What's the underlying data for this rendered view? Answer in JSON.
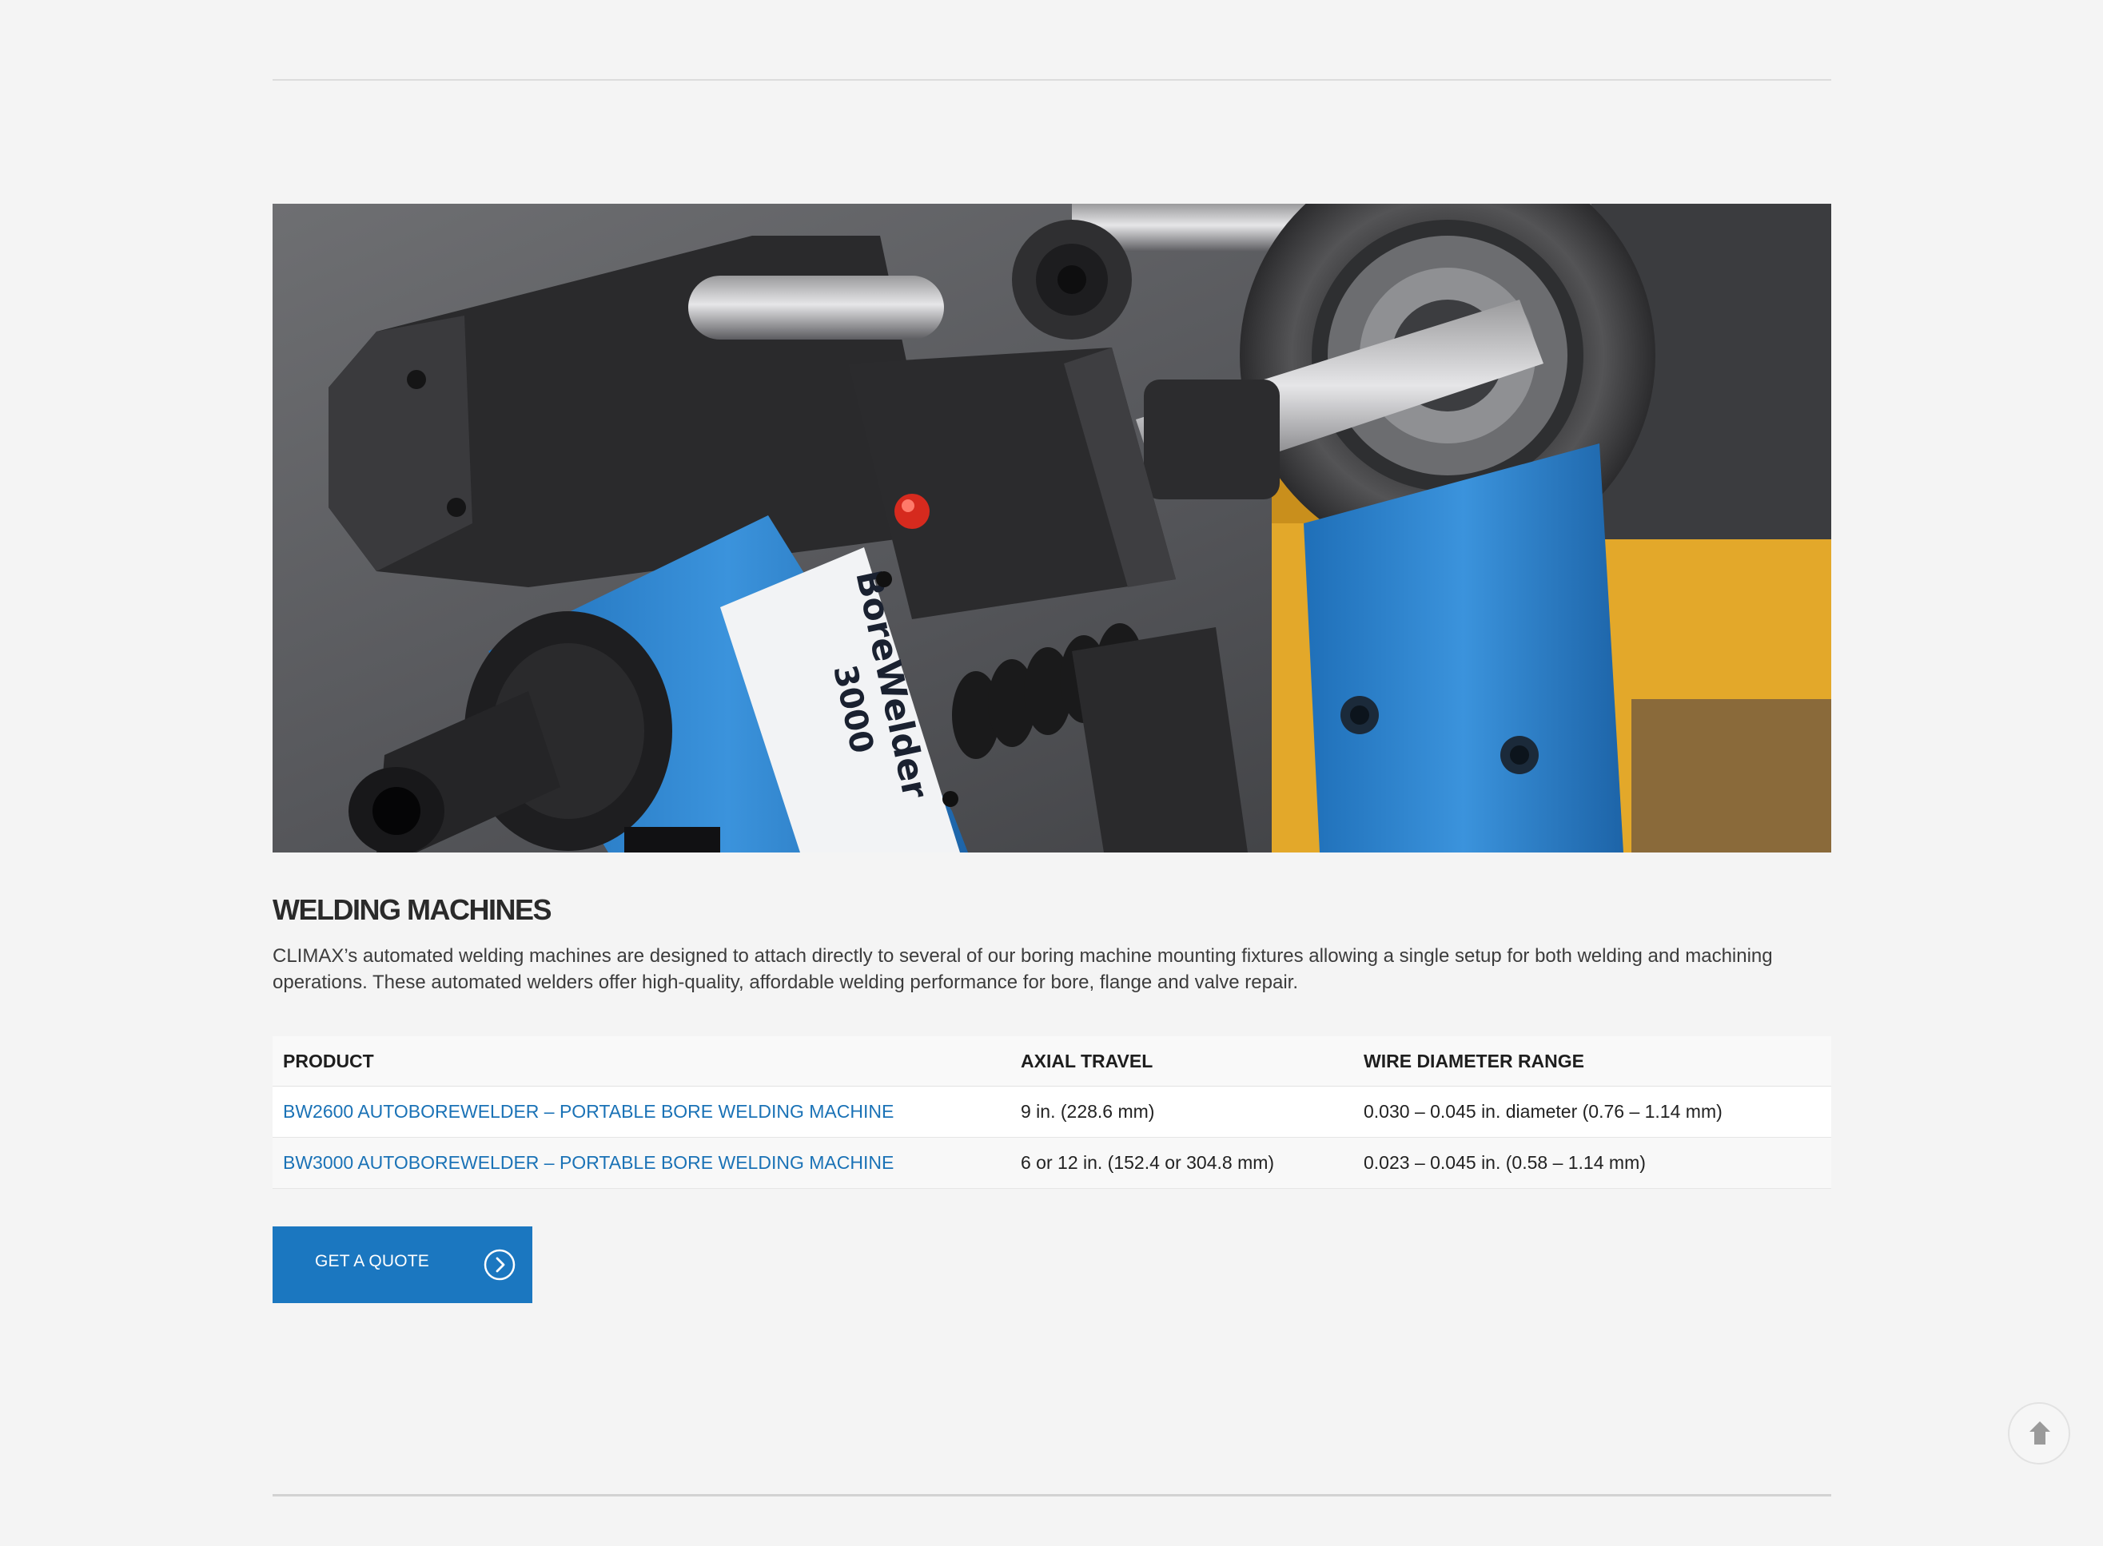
{
  "section": {
    "title": "WELDING MACHINES",
    "description": "CLIMAX’s automated welding machines are designed to attach directly to several of our boring machine mounting fixtures allowing a single setup for both welding and machining operations. These automated welders offer high-quality, affordable welding performance for bore, flange and valve repair."
  },
  "hero": {
    "alt": "BoreWelder 3000",
    "label_text": "BoreWelder",
    "label_model": "3000",
    "colors": {
      "background": "#5a5b5d",
      "blue_part": "#2f86d0",
      "yellow_part": "#e3a82a",
      "black_part": "#2a2a2c"
    }
  },
  "table": {
    "headers": [
      "PRODUCT",
      "AXIAL TRAVEL",
      "WIRE DIAMETER RANGE"
    ],
    "rows": [
      {
        "product": "BW2600 AUTOBOREWELDER – PORTABLE BORE WELDING MACHINE",
        "axial_travel": "9 in. (228.6 mm)",
        "wire_diameter": "0.030 – 0.045 in. diameter (0.76 – 1.14 mm)"
      },
      {
        "product": "BW3000 AUTOBOREWELDER – PORTABLE BORE WELDING MACHINE",
        "axial_travel": "6 or 12 in. (152.4 or 304.8 mm)",
        "wire_diameter": "0.023 – 0.045 in. (0.58 – 1.14 mm)"
      }
    ]
  },
  "cta": {
    "label": "GET A QUOTE",
    "icon": "chevron-right-circle-icon",
    "color": "#1b77c0"
  },
  "scroll_top": {
    "icon": "arrow-up-icon"
  },
  "colors": {
    "link": "#1a72b6",
    "page_background": "#f4f4f4"
  }
}
